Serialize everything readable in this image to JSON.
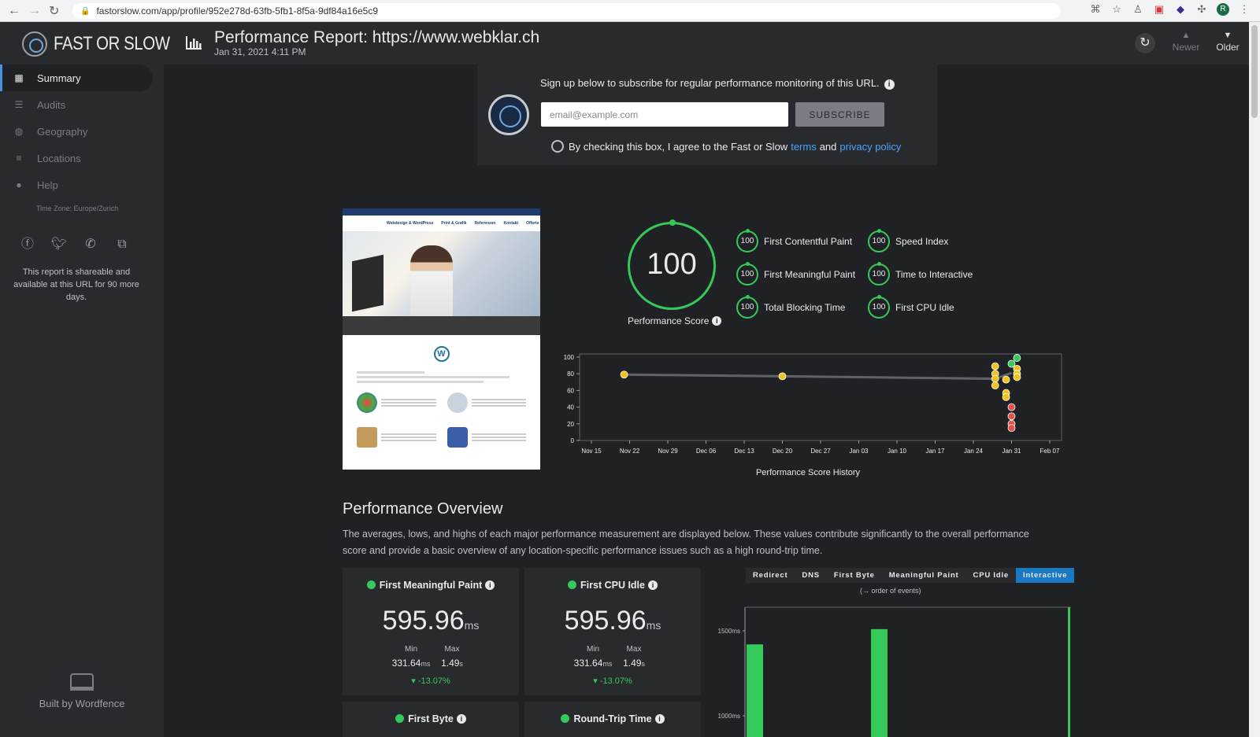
{
  "browser": {
    "url": "fastorslow.com/app/profile/952e278d-63fb-5fb1-8f5a-9df84a16e5c9",
    "profile_initial": "R"
  },
  "app": {
    "brand": "FAST OR SLOW",
    "report_title": "Performance Report: https://www.webklar.ch",
    "report_date": "Jan 31, 2021 4:11 PM",
    "newer_label": "Newer",
    "older_label": "Older"
  },
  "sidebar": {
    "items": [
      {
        "label": "Summary",
        "icon": "grid-icon",
        "active": true
      },
      {
        "label": "Audits",
        "icon": "list-icon",
        "active": false
      },
      {
        "label": "Geography",
        "icon": "globe-icon",
        "active": false
      },
      {
        "label": "Locations",
        "icon": "location-list-icon",
        "active": false
      },
      {
        "label": "Help",
        "icon": "info-icon",
        "active": false
      }
    ],
    "timezone": "Time Zone: Europe/Zurich",
    "share_text": "This report is shareable and available at this URL for 90 more days.",
    "built_by": "Built by Wordfence"
  },
  "subscribe": {
    "prompt": "Sign up below to subscribe for regular performance monitoring of this URL.",
    "email_placeholder": "email@example.com",
    "button": "SUBSCRIBE",
    "agree_prefix": "By checking this box, I agree to the Fast or Slow",
    "terms": "terms",
    "and": "and",
    "privacy": "privacy policy"
  },
  "score": {
    "value": "100",
    "label": "Performance Score"
  },
  "metrics": [
    {
      "score": "100",
      "label": "First Contentful Paint"
    },
    {
      "score": "100",
      "label": "Speed Index"
    },
    {
      "score": "100",
      "label": "First Meaningful Paint"
    },
    {
      "score": "100",
      "label": "Time to Interactive"
    },
    {
      "score": "100",
      "label": "Total Blocking Time"
    },
    {
      "score": "100",
      "label": "First CPU Idle"
    }
  ],
  "colors": {
    "good": "#35c95a",
    "average": "#f0c31c",
    "poor": "#e0524a",
    "accent": "#1a79c2"
  },
  "chart_data": [
    {
      "type": "line",
      "title": "Performance Score History",
      "x_ticks": [
        "Nov 15",
        "Nov 22",
        "Nov 29",
        "Dec 06",
        "Dec 13",
        "Dec 20",
        "Dec 27",
        "Jan 03",
        "Jan 10",
        "Jan 17",
        "Jan 24",
        "Jan 31",
        "Feb 07"
      ],
      "y_ticks": [
        0,
        20,
        40,
        60,
        80,
        100
      ],
      "ylim": [
        0,
        100
      ],
      "series": [
        {
          "points": [
            {
              "x": "2020-11-21",
              "y": 79
            },
            {
              "x": "2020-12-20",
              "y": 77
            },
            {
              "x": "2021-01-28",
              "y": 89
            },
            {
              "x": "2021-01-28",
              "y": 80
            },
            {
              "x": "2021-01-28",
              "y": 74
            },
            {
              "x": "2021-01-28",
              "y": 66
            },
            {
              "x": "2021-01-30",
              "y": 73
            },
            {
              "x": "2021-01-30",
              "y": 57
            },
            {
              "x": "2021-01-30",
              "y": 52
            },
            {
              "x": "2021-01-31",
              "y": 92
            },
            {
              "x": "2021-01-31",
              "y": 40
            },
            {
              "x": "2021-01-31",
              "y": 29
            },
            {
              "x": "2021-01-31",
              "y": 20
            },
            {
              "x": "2021-01-31",
              "y": 15
            },
            {
              "x": "2021-02-01",
              "y": 99
            },
            {
              "x": "2021-02-01",
              "y": 86
            },
            {
              "x": "2021-02-01",
              "y": 80
            },
            {
              "x": "2021-02-01",
              "y": 76
            }
          ]
        }
      ]
    },
    {
      "type": "bar",
      "y_ticks": [
        "1000ms",
        "1500ms"
      ],
      "values_ms": [
        1420,
        1510,
        null,
        null,
        null,
        null
      ],
      "tabs": [
        "Redirect",
        "DNS",
        "First Byte",
        "Meaningful Paint",
        "CPU Idle",
        "Interactive"
      ],
      "active_tab": "Interactive",
      "note": "(→ order of events)"
    }
  ],
  "overview": {
    "title": "Performance Overview",
    "description": "The averages, lows, and highs of each major performance measurement are displayed below. These values contribute significantly to the overall performance score and provide a basic overview of any location-specific performance issues such as a high round-trip time.",
    "cards": [
      {
        "title": "First Meaningful Paint",
        "value": "595.96",
        "unit": "ms",
        "min_label": "Min",
        "min": "331.64",
        "min_unit": "ms",
        "max_label": "Max",
        "max": "1.49",
        "max_unit": "s",
        "delta": "-13.07%"
      },
      {
        "title": "First CPU Idle",
        "value": "595.96",
        "unit": "ms",
        "min_label": "Min",
        "min": "331.64",
        "min_unit": "ms",
        "max_label": "Max",
        "max": "1.49",
        "max_unit": "s",
        "delta": "-13.07%"
      },
      {
        "title": "First Byte"
      },
      {
        "title": "Round-Trip Time"
      }
    ]
  }
}
